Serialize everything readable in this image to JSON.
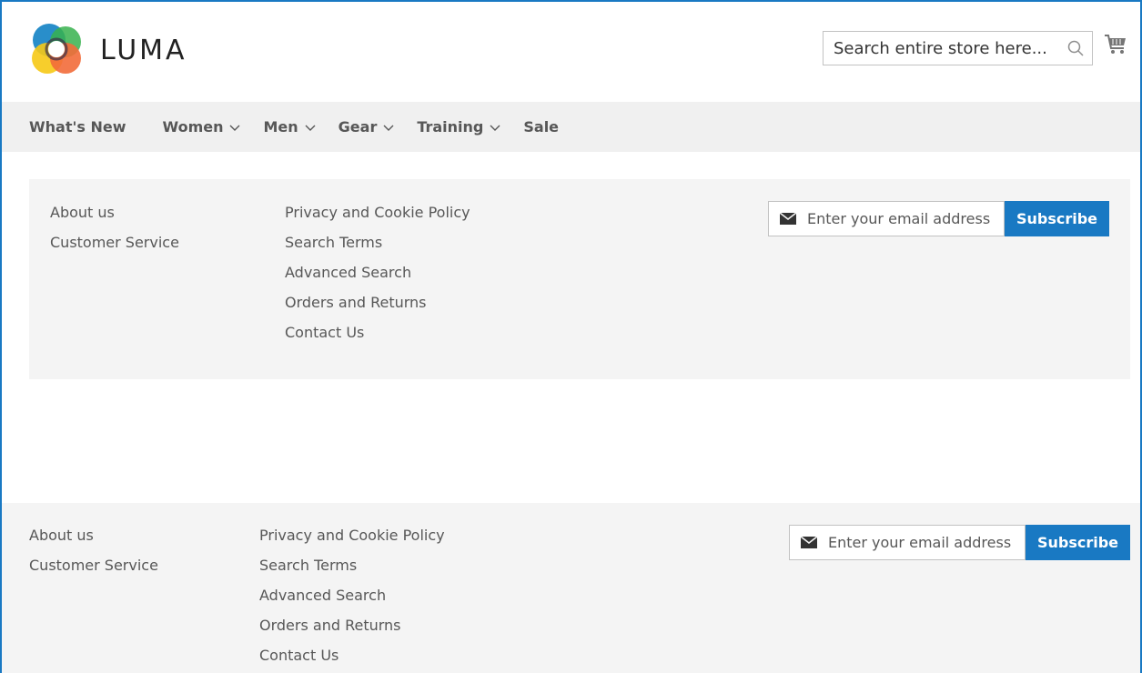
{
  "brand": {
    "name": "LUMA"
  },
  "search": {
    "placeholder": "Search entire store here..."
  },
  "nav": {
    "items": [
      {
        "label": "What's New",
        "dropdown": false
      },
      {
        "label": "Women",
        "dropdown": true
      },
      {
        "label": "Men",
        "dropdown": true
      },
      {
        "label": "Gear",
        "dropdown": true
      },
      {
        "label": "Training",
        "dropdown": true
      },
      {
        "label": "Sale",
        "dropdown": false
      }
    ]
  },
  "footer": {
    "col1": [
      "About us",
      "Customer Service"
    ],
    "col2": [
      "Privacy and Cookie Policy",
      "Search Terms",
      "Advanced Search",
      "Orders and Returns",
      "Contact Us"
    ],
    "newsletter": {
      "placeholder": "Enter your email address",
      "button": "Subscribe"
    }
  },
  "colors": {
    "accent": "#1979c3",
    "nav_bg": "#f0f0f0",
    "panel_bg": "#f4f4f4"
  }
}
